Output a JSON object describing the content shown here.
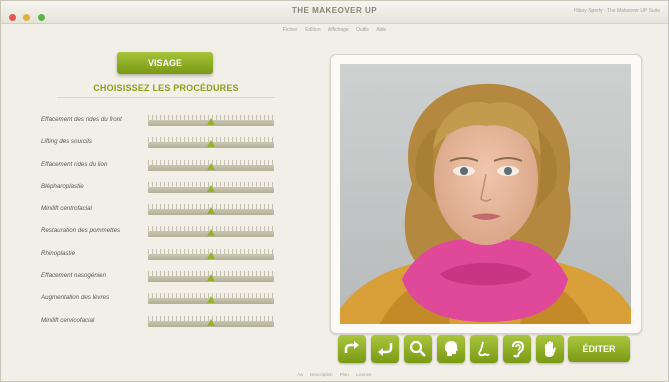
{
  "window": {
    "title": "THE MAKEOVER UP",
    "title_right": "Hilary Sperty · The Makeover UP Suite"
  },
  "menu": {
    "items": [
      "Fichier",
      "Édition",
      "Affichage",
      "Outils",
      "Aide"
    ]
  },
  "sidebar": {
    "category_button": "VISAGE",
    "heading": "CHOISISSEZ LES PROCÉDURES",
    "procedures": [
      {
        "label": "Effacement des rides du front",
        "level": 0.5
      },
      {
        "label": "Lifting des sourcils",
        "level": 0.5
      },
      {
        "label": "Effacement rides du lion",
        "level": 0.5
      },
      {
        "label": "Blépharoplastie",
        "level": 0.5
      },
      {
        "label": "Minilift centrofacial",
        "level": 0.5
      },
      {
        "label": "Restauration des pommettes",
        "level": 0.5
      },
      {
        "label": "Rhinoplastie",
        "level": 0.5
      },
      {
        "label": "Effacement nasogénien",
        "level": 0.5
      },
      {
        "label": "Augmentation des lèvres",
        "level": 0.5
      },
      {
        "label": "Minilift cervicofacial",
        "level": 0.5
      }
    ]
  },
  "toolbar": {
    "tools": [
      "redo-arrow-icon",
      "undo-arrow-icon",
      "magnifier-icon",
      "head-profile-icon",
      "nose-icon",
      "ear-icon",
      "hand-icon"
    ],
    "edit_label": "ÉDITER"
  },
  "footer": {
    "items": [
      "Aa",
      "Description",
      "Plan",
      "Licence"
    ]
  },
  "colors": {
    "accent": "#8ba21a",
    "button": "#94b22a"
  }
}
